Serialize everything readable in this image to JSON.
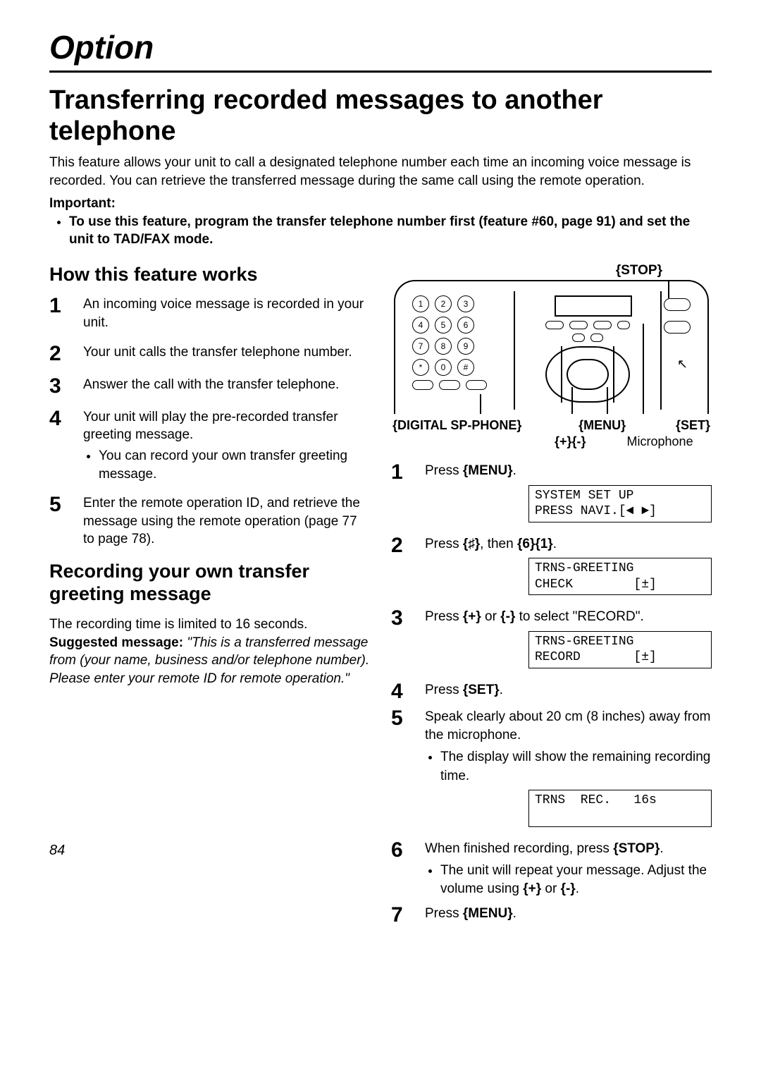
{
  "chapter": "Option",
  "section_title": "Transferring recorded messages to another telephone",
  "intro": "This feature allows your unit to call a designated telephone number each time an incoming voice message is recorded. You can retrieve the transferred message during the same call using the remote operation.",
  "important_label": "Important:",
  "important_bullet": "To use this feature, program the transfer telephone number first (feature #60, page 91) and set the unit to TAD/FAX mode.",
  "how_heading": "How this feature works",
  "left_steps": [
    {
      "n": "1",
      "text": "An incoming voice message is recorded in your unit."
    },
    {
      "n": "2",
      "text": "Your unit calls the transfer telephone number."
    },
    {
      "n": "3",
      "text": "Answer the call with the transfer telephone."
    },
    {
      "n": "4",
      "text": "Your unit will play the pre-recorded transfer greeting message.",
      "sub": "You can record your own transfer greeting message."
    },
    {
      "n": "5",
      "text": "Enter the remote operation ID, and retrieve the message using the remote operation (page 77 to page 78)."
    }
  ],
  "rec_heading": "Recording your own transfer greeting message",
  "rec_note_plain": "The recording time is limited to 16 seconds.",
  "rec_note_label": "Suggested message:",
  "rec_note_msg": "\"This is a transferred message from (your name, business and/or telephone number). Please enter your remote ID for remote operation.\"",
  "diagram": {
    "stop": "{STOP}",
    "labels": {
      "dsp": "{DIGITAL SP-PHONE}",
      "menu": "{MENU}",
      "set": "{SET}",
      "pm": "{+}{-}",
      "mic": "Microphone"
    },
    "keys": [
      [
        "1",
        "2",
        "3"
      ],
      [
        "4",
        "5",
        "6"
      ],
      [
        "7",
        "8",
        "9"
      ],
      [
        "*",
        "0",
        "#"
      ]
    ]
  },
  "right_steps": {
    "s1": {
      "n": "1",
      "pre": "Press ",
      "key": "{MENU}",
      "post": ".",
      "lcd": "SYSTEM SET UP\nPRESS NAVI.[◄ ►]"
    },
    "s2": {
      "n": "2",
      "pre": "Press ",
      "k1": "{♯}",
      "mid": ", then ",
      "k2": "{6}{1}",
      "post": ".",
      "lcd": "TRNS-GREETING\nCHECK        [±]"
    },
    "s3": {
      "n": "3",
      "pre": "Press ",
      "k1": "{+}",
      "mid": " or ",
      "k2": "{-}",
      "post": " to select \"RECORD\".",
      "lcd": "TRNS-GREETING\nRECORD       [±]"
    },
    "s4": {
      "n": "4",
      "pre": "Press ",
      "key": "{SET}",
      "post": "."
    },
    "s5": {
      "n": "5",
      "text": "Speak clearly about 20 cm (8 inches) away from the microphone.",
      "sub": "The display will show the remaining recording time.",
      "lcd": "TRNS  REC.   16s\n "
    },
    "s6": {
      "n": "6",
      "pre": "When finished recording, press ",
      "key": "{STOP}",
      "post": ".",
      "sub_pre": "The unit will repeat your message. Adjust the volume using ",
      "k1": "{+}",
      "mid": " or ",
      "k2": "{-}",
      "sub_post": "."
    },
    "s7": {
      "n": "7",
      "pre": "Press ",
      "key": "{MENU}",
      "post": "."
    }
  },
  "page_number": "84"
}
